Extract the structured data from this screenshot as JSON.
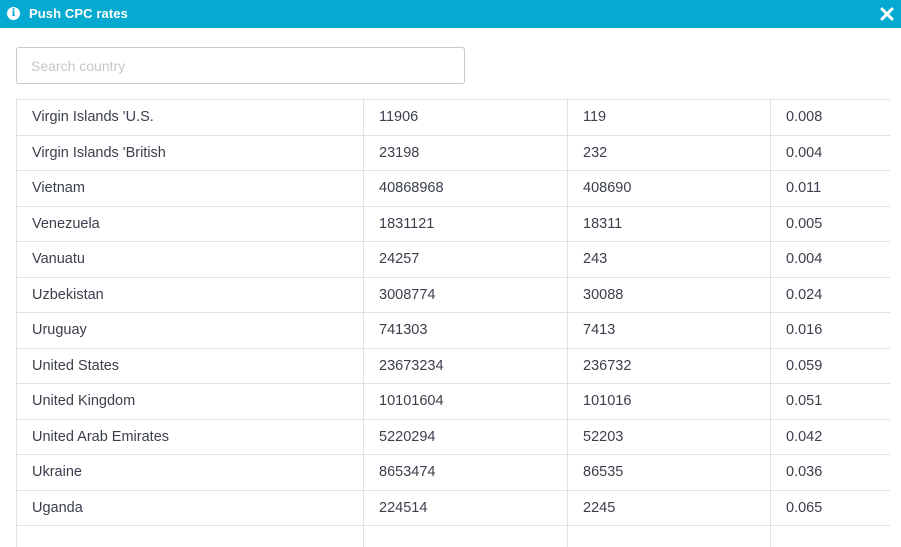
{
  "dialog": {
    "title": "Push CPC rates",
    "close_label": "✕"
  },
  "search": {
    "placeholder": "Search country",
    "value": ""
  },
  "rows": [
    {
      "country": "Virgin Islands 'U.S.",
      "col2": "11906",
      "col3": "119",
      "col4": "0.008"
    },
    {
      "country": "Virgin Islands 'British",
      "col2": "23198",
      "col3": "232",
      "col4": "0.004"
    },
    {
      "country": "Vietnam",
      "col2": "40868968",
      "col3": "408690",
      "col4": "0.011"
    },
    {
      "country": "Venezuela",
      "col2": "1831121",
      "col3": "18311",
      "col4": "0.005"
    },
    {
      "country": "Vanuatu",
      "col2": "24257",
      "col3": "243",
      "col4": "0.004"
    },
    {
      "country": "Uzbekistan",
      "col2": "3008774",
      "col3": "30088",
      "col4": "0.024"
    },
    {
      "country": "Uruguay",
      "col2": "741303",
      "col3": "7413",
      "col4": "0.016"
    },
    {
      "country": "United States",
      "col2": "23673234",
      "col3": "236732",
      "col4": "0.059"
    },
    {
      "country": "United Kingdom",
      "col2": "10101604",
      "col3": "101016",
      "col4": "0.051"
    },
    {
      "country": "United Arab Emirates",
      "col2": "5220294",
      "col3": "52203",
      "col4": "0.042"
    },
    {
      "country": "Ukraine",
      "col2": "8653474",
      "col3": "86535",
      "col4": "0.036"
    },
    {
      "country": "Uganda",
      "col2": "224514",
      "col3": "2245",
      "col4": "0.065"
    },
    {
      "country": "",
      "col2": "",
      "col3": "",
      "col4": ""
    }
  ],
  "colors": {
    "titlebar": "#06a9cf",
    "border": "#dfe2e6",
    "text": "#3a3f4b"
  }
}
